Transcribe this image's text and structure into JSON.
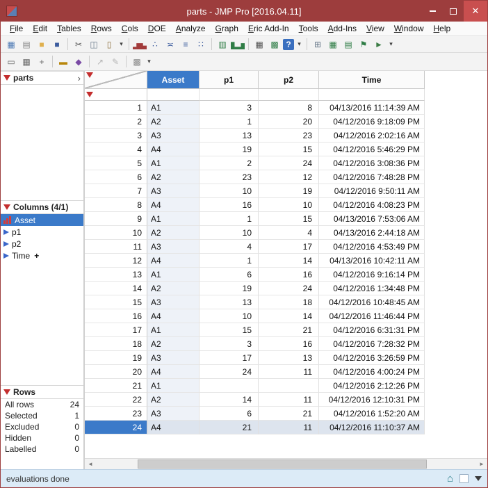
{
  "window": {
    "title": "parts - JMP Pro [2016.04.11]",
    "close_glyph": "✕"
  },
  "menu": {
    "items": [
      "File",
      "Edit",
      "Tables",
      "Rows",
      "Cols",
      "DOE",
      "Analyze",
      "Graph",
      "Eric Add-In",
      "Tools",
      "Add-Ins",
      "View",
      "Window",
      "Help"
    ]
  },
  "toolbar1": [
    {
      "name": "new-data-table-icon",
      "glyph": "▦",
      "color": "#4f7bb5"
    },
    {
      "name": "new-journal-icon",
      "glyph": "▤",
      "color": "#888888"
    },
    {
      "name": "open-icon",
      "glyph": "■",
      "color": "#e0b04e"
    },
    {
      "name": "save-icon",
      "glyph": "■",
      "color": "#3c5c9e"
    },
    {
      "sep": true
    },
    {
      "name": "cut-icon",
      "glyph": "✂",
      "color": "#555555"
    },
    {
      "name": "copy-icon",
      "glyph": "◫",
      "color": "#667788"
    },
    {
      "name": "paste-icon",
      "glyph": "▯",
      "color": "#8a6d3b"
    },
    {
      "name": "paste-dropdown-icon",
      "glyph": "▾",
      "color": "#444444",
      "small": true
    },
    {
      "sep": true
    },
    {
      "name": "distribution-icon",
      "glyph": "▂▅▃",
      "color": "#a23b3b"
    },
    {
      "name": "fit-y-by-x-icon",
      "glyph": "∴",
      "color": "#3c5c9e"
    },
    {
      "name": "matched-pairs-icon",
      "glyph": "≍",
      "color": "#3c5c9e"
    },
    {
      "name": "fit-model-icon",
      "glyph": "≡",
      "color": "#3c5c9e"
    },
    {
      "name": "multivariate-icon",
      "glyph": "∷",
      "color": "#3c5c9e"
    },
    {
      "sep": true
    },
    {
      "name": "graph-builder-icon",
      "glyph": "▥",
      "color": "#2f7d46"
    },
    {
      "name": "chart-icon",
      "glyph": "▆▂▅",
      "color": "#2f7d46"
    },
    {
      "sep": true
    },
    {
      "name": "tabulate-icon",
      "glyph": "▦",
      "color": "#555555"
    },
    {
      "name": "excel-import-icon",
      "glyph": "▩",
      "color": "#2f7d46"
    },
    {
      "name": "help-icon",
      "glyph": "?",
      "color": "#ffffff",
      "bg": "#3a6fbf"
    },
    {
      "name": "toolbar1-dropdown-icon",
      "glyph": "▾",
      "color": "#444444",
      "small": true
    },
    {
      "sep": true
    },
    {
      "name": "data-filter-icon",
      "glyph": "⊞",
      "color": "#667788"
    },
    {
      "name": "summary-icon",
      "glyph": "▦",
      "color": "#2f7d46"
    },
    {
      "name": "subset-icon",
      "glyph": "▤",
      "color": "#2f7d46"
    },
    {
      "name": "flag-icon",
      "glyph": "⚑",
      "color": "#2f7d46"
    },
    {
      "name": "run-script-icon",
      "glyph": "►",
      "color": "#3c7d46"
    },
    {
      "name": "toolbar1-dropdown2-icon",
      "glyph": "▾",
      "color": "#444444",
      "small": true
    }
  ],
  "toolbar2": [
    {
      "name": "select-tool-icon",
      "glyph": "▭",
      "color": "#666666"
    },
    {
      "name": "table-tools-icon",
      "glyph": "▦",
      "color": "#666666"
    },
    {
      "name": "move-tool-icon",
      "glyph": "+",
      "color": "#666666"
    },
    {
      "sep": true
    },
    {
      "name": "journal-icon",
      "glyph": "▬",
      "color": "#b8860b"
    },
    {
      "name": "snapshot-icon",
      "glyph": "◆",
      "color": "#7a4aa5"
    },
    {
      "sep": true
    },
    {
      "name": "arrow-tool-icon",
      "glyph": "↗",
      "color": "#b5b5b5"
    },
    {
      "name": "annotate-tool-icon",
      "glyph": "✎",
      "color": "#b5b5b5"
    },
    {
      "sep": true
    },
    {
      "name": "cube-view-icon",
      "glyph": "▩",
      "color": "#8a8a8a"
    },
    {
      "name": "toolbar2-dropdown-icon",
      "glyph": "▾",
      "color": "#444444",
      "small": true
    }
  ],
  "sidebar": {
    "table_panel": {
      "title": "parts",
      "expand_glyph": "›"
    },
    "columns_panel": {
      "title": "Columns (4/1)",
      "items": [
        {
          "label": "Asset",
          "type": "nominal",
          "selected": true
        },
        {
          "label": "p1",
          "type": "continuous"
        },
        {
          "label": "p2",
          "type": "continuous"
        },
        {
          "label": "Time",
          "type": "continuous",
          "badge": "+"
        }
      ]
    },
    "rows_panel": {
      "title": "Rows",
      "stats": [
        {
          "label": "All rows",
          "value": "24"
        },
        {
          "label": "Selected",
          "value": "1"
        },
        {
          "label": "Excluded",
          "value": "0"
        },
        {
          "label": "Hidden",
          "value": "0"
        },
        {
          "label": "Labelled",
          "value": "0"
        }
      ]
    }
  },
  "table": {
    "columns": [
      "Asset",
      "p1",
      "p2",
      "Time"
    ],
    "selected_column": "Asset",
    "selected_row": 24,
    "rows": [
      {
        "n": 1,
        "asset": "A1",
        "p1": "3",
        "p2": "8",
        "time": "04/13/2016 11:14:39 AM"
      },
      {
        "n": 2,
        "asset": "A2",
        "p1": "1",
        "p2": "20",
        "time": "04/12/2016 9:18:09 PM"
      },
      {
        "n": 3,
        "asset": "A3",
        "p1": "13",
        "p2": "23",
        "time": "04/12/2016 2:02:16 AM"
      },
      {
        "n": 4,
        "asset": "A4",
        "p1": "19",
        "p2": "15",
        "time": "04/12/2016 5:46:29 PM"
      },
      {
        "n": 5,
        "asset": "A1",
        "p1": "2",
        "p2": "24",
        "time": "04/12/2016 3:08:36 PM"
      },
      {
        "n": 6,
        "asset": "A2",
        "p1": "23",
        "p2": "12",
        "time": "04/12/2016 7:48:28 PM"
      },
      {
        "n": 7,
        "asset": "A3",
        "p1": "10",
        "p2": "19",
        "time": "04/12/2016 9:50:11 AM"
      },
      {
        "n": 8,
        "asset": "A4",
        "p1": "16",
        "p2": "10",
        "time": "04/12/2016 4:08:23 PM"
      },
      {
        "n": 9,
        "asset": "A1",
        "p1": "1",
        "p2": "15",
        "time": "04/13/2016 7:53:06 AM"
      },
      {
        "n": 10,
        "asset": "A2",
        "p1": "10",
        "p2": "4",
        "time": "04/13/2016 2:44:18 AM"
      },
      {
        "n": 11,
        "asset": "A3",
        "p1": "4",
        "p2": "17",
        "time": "04/12/2016 4:53:49 PM"
      },
      {
        "n": 12,
        "asset": "A4",
        "p1": "1",
        "p2": "14",
        "time": "04/13/2016 10:42:11 AM"
      },
      {
        "n": 13,
        "asset": "A1",
        "p1": "6",
        "p2": "16",
        "time": "04/12/2016 9:16:14 PM"
      },
      {
        "n": 14,
        "asset": "A2",
        "p1": "19",
        "p2": "24",
        "time": "04/12/2016 1:34:48 PM"
      },
      {
        "n": 15,
        "asset": "A3",
        "p1": "13",
        "p2": "18",
        "time": "04/12/2016 10:48:45 AM"
      },
      {
        "n": 16,
        "asset": "A4",
        "p1": "10",
        "p2": "14",
        "time": "04/12/2016 11:46:44 PM"
      },
      {
        "n": 17,
        "asset": "A1",
        "p1": "15",
        "p2": "21",
        "time": "04/12/2016 6:31:31 PM"
      },
      {
        "n": 18,
        "asset": "A2",
        "p1": "3",
        "p2": "16",
        "time": "04/12/2016 7:28:32 PM"
      },
      {
        "n": 19,
        "asset": "A3",
        "p1": "17",
        "p2": "13",
        "time": "04/12/2016 3:26:59 PM"
      },
      {
        "n": 20,
        "asset": "A4",
        "p1": "24",
        "p2": "11",
        "time": "04/12/2016 4:00:24 PM"
      },
      {
        "n": 21,
        "asset": "A1",
        "p1": "",
        "p2": "",
        "time": "04/12/2016 2:12:26 PM"
      },
      {
        "n": 22,
        "asset": "A2",
        "p1": "14",
        "p2": "11",
        "time": "04/12/2016 12:10:31 PM"
      },
      {
        "n": 23,
        "asset": "A3",
        "p1": "6",
        "p2": "21",
        "time": "04/12/2016 1:52:20 AM"
      },
      {
        "n": 24,
        "asset": "A4",
        "p1": "21",
        "p2": "11",
        "time": "04/12/2016 11:10:37 AM"
      }
    ]
  },
  "scrollbar": {
    "left_glyph": "◄",
    "right_glyph": "►"
  },
  "statusbar": {
    "message": "evaluations done",
    "home_glyph": "⌂"
  },
  "colors": {
    "accent_blue": "#3b7ac9",
    "titlebar": "#9d3d3d",
    "close_button": "#c94f4f",
    "status_bg": "#dcebf7",
    "red_triangle": "#c42e2e",
    "nominal_icon": "#d43c3c",
    "continuous_icon": "#3a66c9"
  }
}
